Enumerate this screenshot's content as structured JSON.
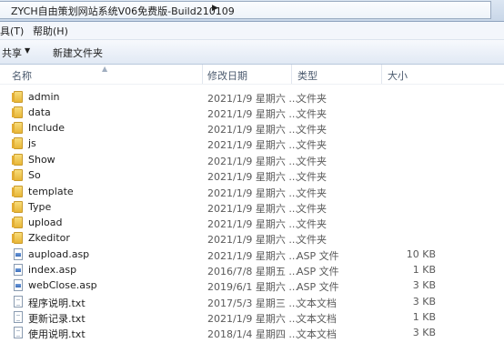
{
  "address": {
    "path": "ZYCH自由策划网站系统V06免费版-Build210109",
    "arrow": "▶"
  },
  "menu": {
    "tools": "具(T)",
    "help": "帮助(H)"
  },
  "commands": {
    "share": "共享",
    "new_folder": "新建文件夹"
  },
  "columns": {
    "name": "名称",
    "date": "修改日期",
    "type": "类型",
    "size": "大小"
  },
  "files": [
    {
      "name": "admin",
      "date": "2021/1/9 星期六 ...",
      "type": "文件夹",
      "size": "",
      "icon": "folder-icon"
    },
    {
      "name": "data",
      "date": "2021/1/9 星期六 ...",
      "type": "文件夹",
      "size": "",
      "icon": "folder-icon"
    },
    {
      "name": "Include",
      "date": "2021/1/9 星期六 ...",
      "type": "文件夹",
      "size": "",
      "icon": "folder-icon"
    },
    {
      "name": "js",
      "date": "2021/1/9 星期六 ...",
      "type": "文件夹",
      "size": "",
      "icon": "folder-icon"
    },
    {
      "name": "Show",
      "date": "2021/1/9 星期六 ...",
      "type": "文件夹",
      "size": "",
      "icon": "folder-icon"
    },
    {
      "name": "So",
      "date": "2021/1/9 星期六 ...",
      "type": "文件夹",
      "size": "",
      "icon": "folder-icon"
    },
    {
      "name": "template",
      "date": "2021/1/9 星期六 ...",
      "type": "文件夹",
      "size": "",
      "icon": "folder-icon"
    },
    {
      "name": "Type",
      "date": "2021/1/9 星期六 ...",
      "type": "文件夹",
      "size": "",
      "icon": "folder-icon"
    },
    {
      "name": "upload",
      "date": "2021/1/9 星期六 ...",
      "type": "文件夹",
      "size": "",
      "icon": "folder-icon"
    },
    {
      "name": "Zkeditor",
      "date": "2021/1/9 星期六 ...",
      "type": "文件夹",
      "size": "",
      "icon": "folder-icon"
    },
    {
      "name": "aupload.asp",
      "date": "2021/1/9 星期六 ...",
      "type": "ASP 文件",
      "size": "10 KB",
      "icon": "asp-file-icon"
    },
    {
      "name": "index.asp",
      "date": "2016/7/8 星期五 ...",
      "type": "ASP 文件",
      "size": "1 KB",
      "icon": "asp-file-icon"
    },
    {
      "name": "webClose.asp",
      "date": "2019/6/1 星期六 ...",
      "type": "ASP 文件",
      "size": "3 KB",
      "icon": "asp-file-icon"
    },
    {
      "name": "程序说明.txt",
      "date": "2017/5/3 星期三 ...",
      "type": "文本文档",
      "size": "3 KB",
      "icon": "text-file-icon"
    },
    {
      "name": "更新记录.txt",
      "date": "2021/1/9 星期六 ...",
      "type": "文本文档",
      "size": "1 KB",
      "icon": "text-file-icon"
    },
    {
      "name": "使用说明.txt",
      "date": "2018/1/4 星期四 ...",
      "type": "文本文档",
      "size": "3 KB",
      "icon": "text-file-icon"
    }
  ]
}
